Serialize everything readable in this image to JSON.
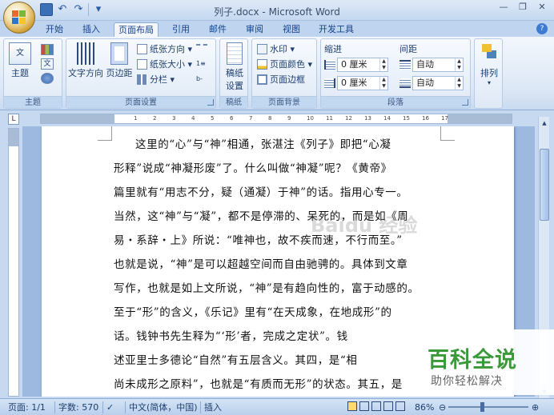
{
  "window": {
    "title": "列子.docx - Microsoft Word"
  },
  "ribbon_tabs": [
    "开始",
    "插入",
    "页面布局",
    "引用",
    "邮件",
    "审阅",
    "视图",
    "开发工具"
  ],
  "active_tab": "页面布局",
  "groups": {
    "theme": {
      "label": "主题",
      "theme_btn": "主题"
    },
    "page_setup": {
      "label": "页面设置",
      "text_direction": "文字方向",
      "margins": "页边距",
      "orientation": "纸张方向",
      "size": "纸张大小",
      "columns": "分栏"
    },
    "draft": {
      "label": "稿纸",
      "draft_btn_line1": "稿纸",
      "draft_btn_line2": "设置"
    },
    "background": {
      "label": "页面背景",
      "watermark": "水印",
      "page_color": "页面颜色",
      "page_border": "页面边框"
    },
    "paragraph": {
      "label": "段落",
      "indent_title": "缩进",
      "spacing_title": "间距",
      "indent_left": "0 厘米",
      "indent_right": "0 厘米",
      "spacing_before": "自动",
      "spacing_after": "自动"
    },
    "arrange": {
      "arrange_btn": "排列"
    }
  },
  "document": {
    "lines": [
      "这里的“心”与“神”相通，张湛注《列子》即把“心凝",
      "形释”说成“神凝形废”了。什么叫做“神凝”呢？《黄帝》",
      "篇里就有“用志不分，疑（通凝）于神”的话。指用心专一。",
      "当然，这“神”与“凝”，都不是停滞的、呆死的，而是如《周",
      "易・系辞・上》所说：“唯神也，故不疾而速，不行而至。”",
      "也就是说，“神”是可以超越空间而自由驰骋的。具体到文章",
      "写作，也就是如上文所说，“神”是有趋向性的，富于动感的。",
      "至于“形”的含义，《乐记》里有“在天成象，在地成形”的",
      "话。钱钟书先生释为“‘形’者，完成之定状”。钱",
      "述亚里士多德论“自然”有五层含义。其四，是“相",
      "尚未成形之原料”，也就是“有质而无形”的状态。其五，是"
    ]
  },
  "status_bar": {
    "page": "页面: 1/1",
    "words": "字数: 570",
    "language": "中文(简体，中国)",
    "mode": "插入",
    "zoom": "86%"
  },
  "watermark": {
    "brand": "百科全说",
    "slogan": "助你轻松解决",
    "baidu": "Baidu 经验"
  }
}
